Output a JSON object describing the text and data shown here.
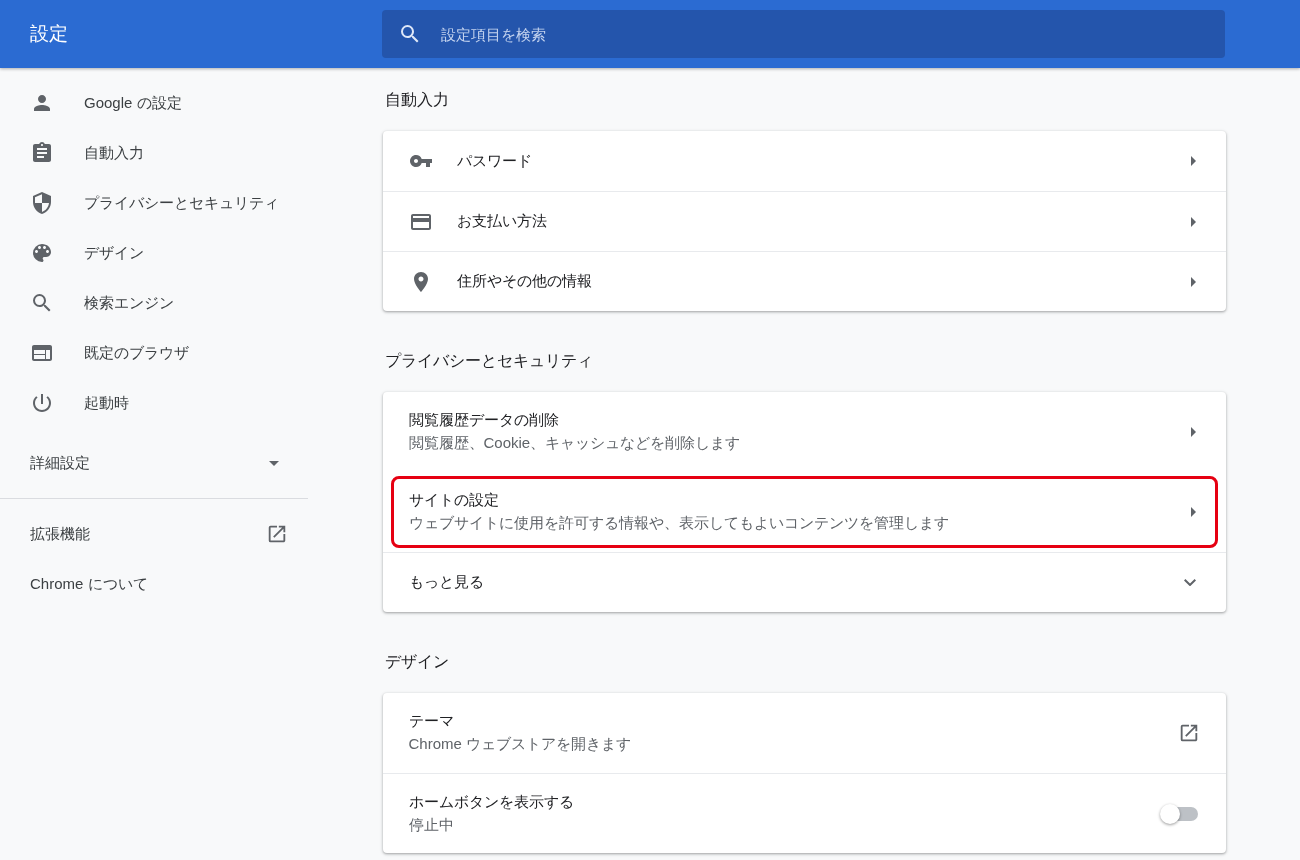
{
  "header": {
    "title": "設定",
    "search": {
      "placeholder": "設定項目を検索"
    }
  },
  "sidebar": {
    "items": [
      {
        "label": "Google の設定"
      },
      {
        "label": "自動入力"
      },
      {
        "label": "プライバシーとセキュリティ"
      },
      {
        "label": "デザイン"
      },
      {
        "label": "検索エンジン"
      },
      {
        "label": "既定のブラウザ"
      },
      {
        "label": "起動時"
      }
    ],
    "advanced": {
      "label": "詳細設定",
      "expanded": false
    },
    "links": [
      {
        "label": "拡張機能",
        "external": true
      },
      {
        "label": "Chrome について",
        "external": false
      }
    ]
  },
  "sections": [
    {
      "title": "自動入力",
      "rows": [
        {
          "kind": "nav",
          "title": "パスワード",
          "highlighted": false
        },
        {
          "kind": "nav",
          "title": "お支払い方法",
          "highlighted": false
        },
        {
          "kind": "nav",
          "title": "住所やその他の情報",
          "highlighted": false
        }
      ]
    },
    {
      "title": "プライバシーとセキュリティ",
      "rows": [
        {
          "kind": "nav",
          "title": "閲覧履歴データの削除",
          "subtitle": "閲覧履歴、Cookie、キャッシュなどを削除します",
          "highlighted": false
        },
        {
          "kind": "nav",
          "title": "サイトの設定",
          "subtitle": "ウェブサイトに使用を許可する情報や、表示してもよいコンテンツを管理します",
          "highlighted": true
        },
        {
          "kind": "expand",
          "title": "もっと見る",
          "highlighted": false,
          "expanded": false
        }
      ]
    },
    {
      "title": "デザイン",
      "rows": [
        {
          "kind": "external",
          "title": "テーマ",
          "subtitle": "Chrome ウェブストアを開きます",
          "highlighted": false
        },
        {
          "kind": "toggle",
          "title": "ホームボタンを表示する",
          "subtitle": "停止中",
          "highlighted": false,
          "on": false
        }
      ]
    }
  ]
}
